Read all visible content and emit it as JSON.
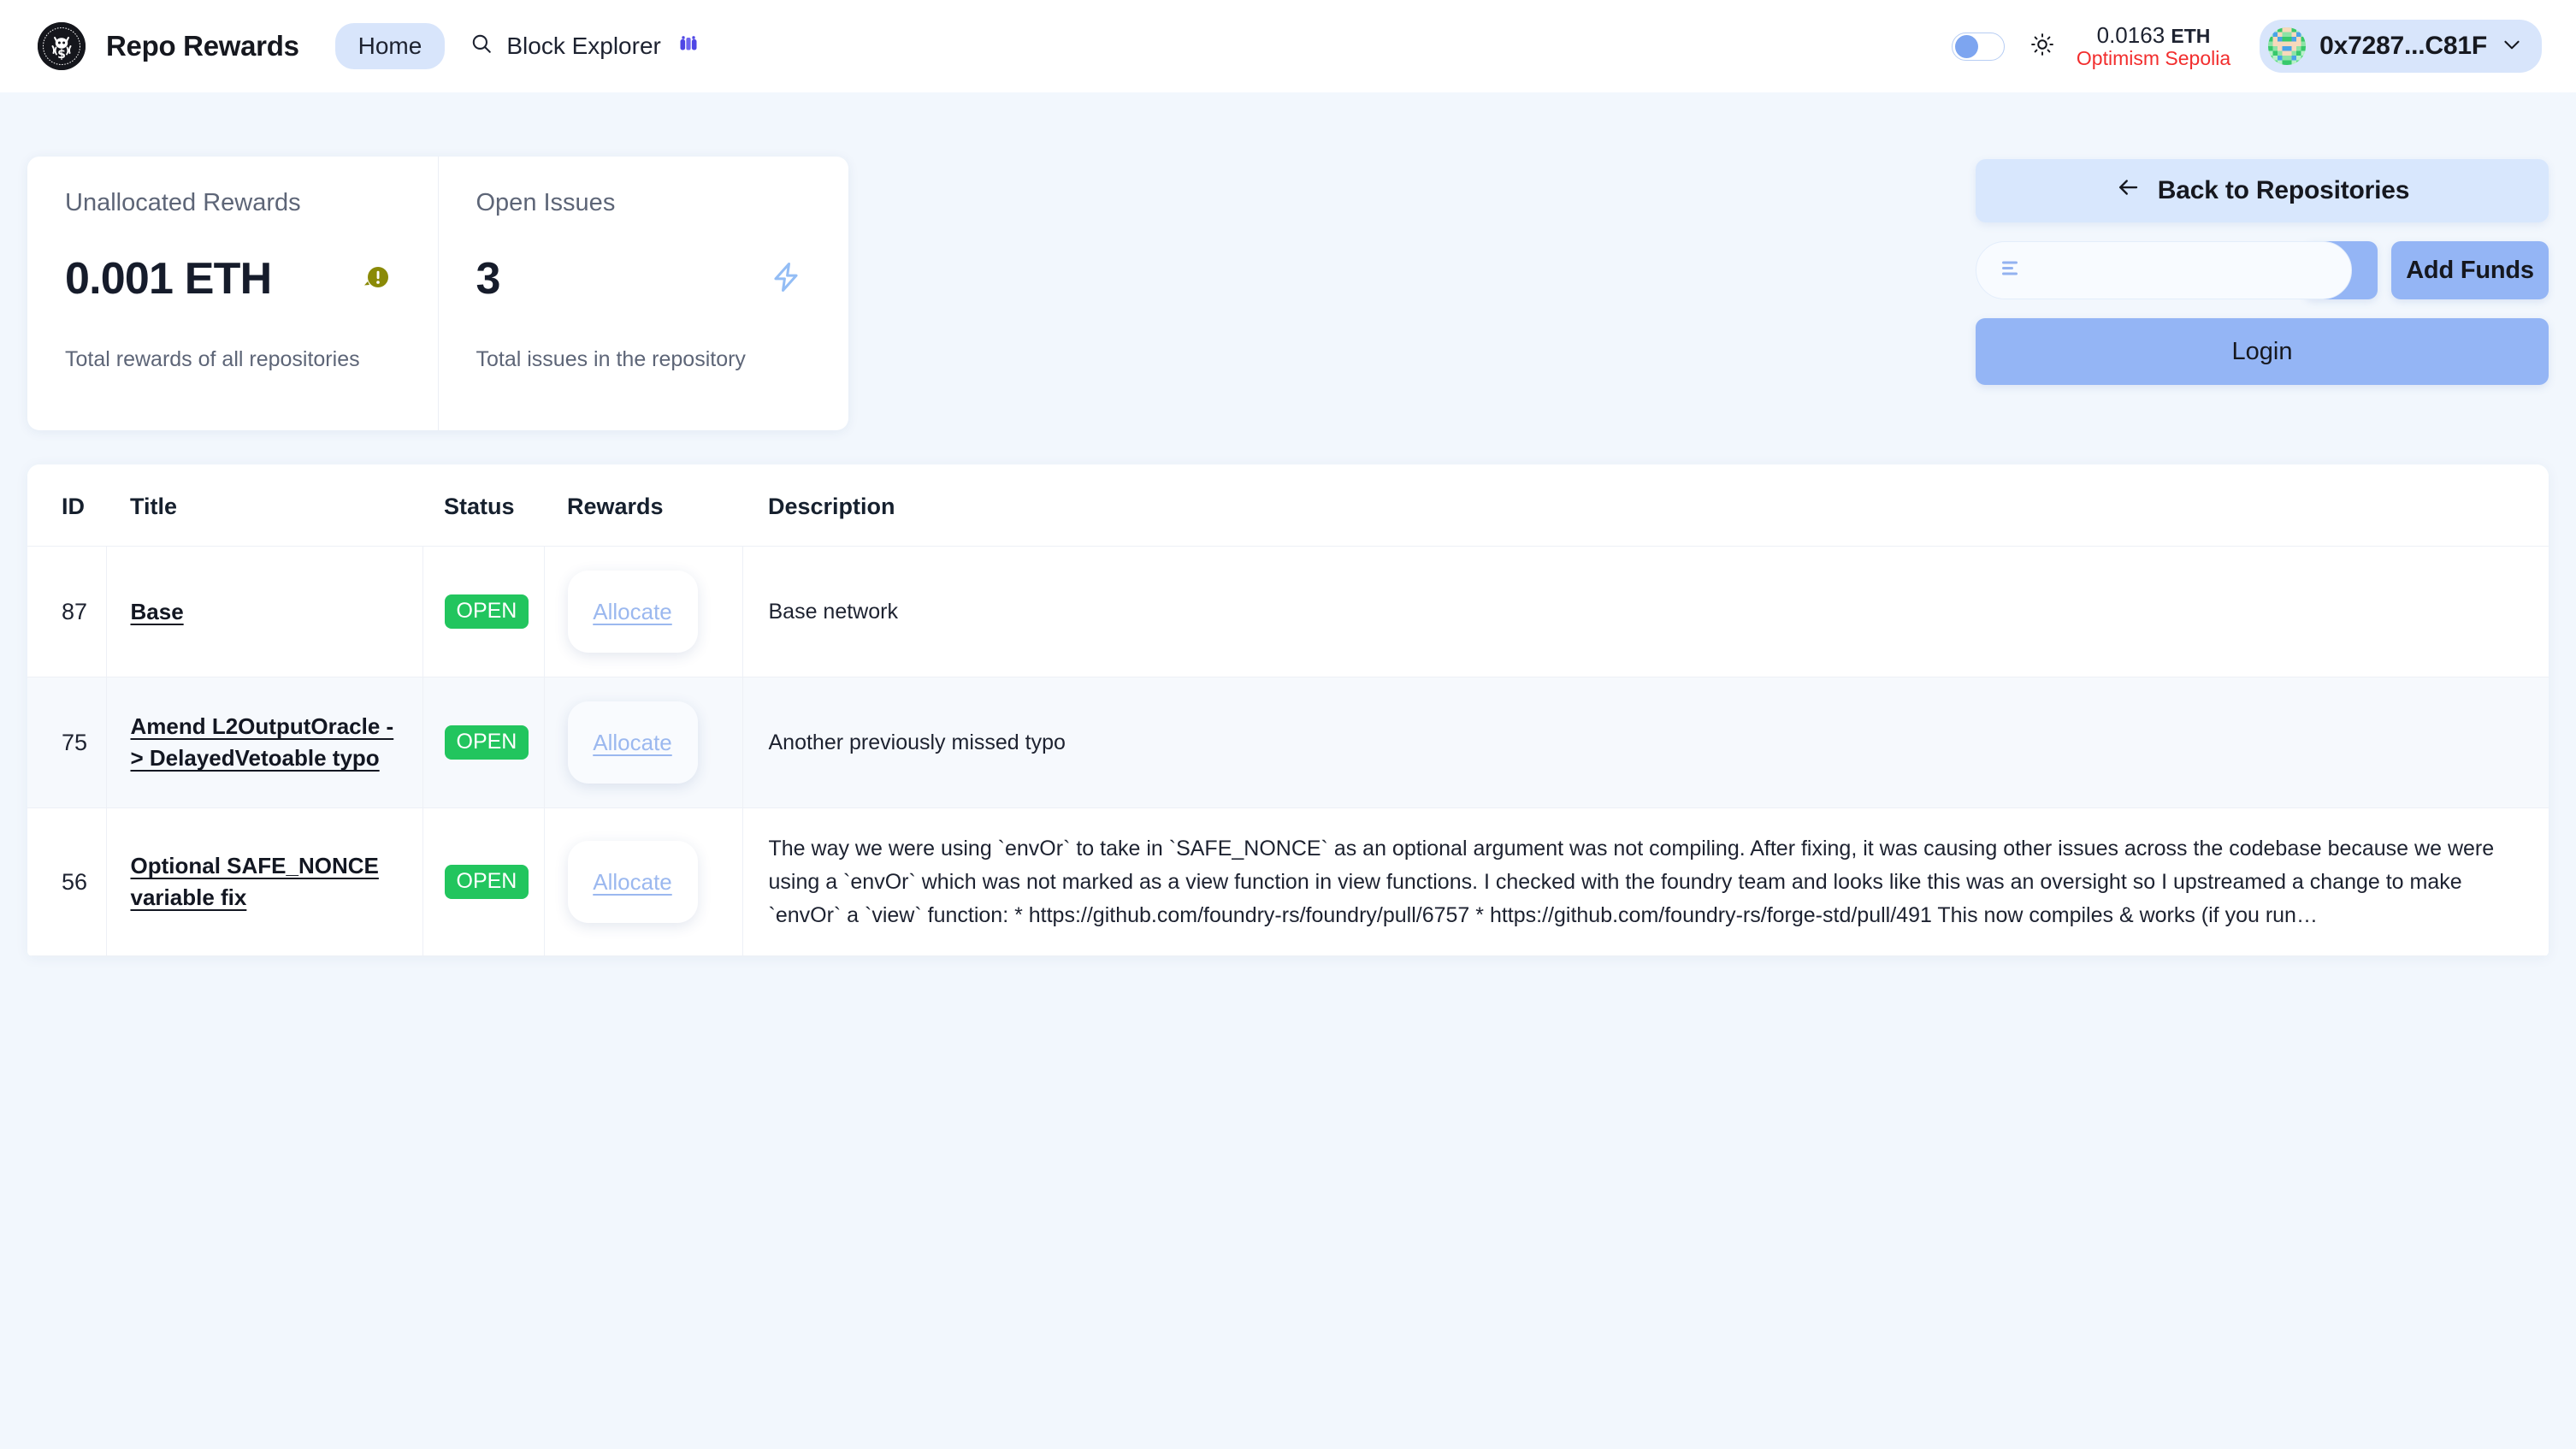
{
  "header": {
    "logo_icon": "repo-rewards-octocat-logo",
    "brand_title": "Repo Rewards",
    "nav": {
      "home_label": "Home",
      "block_explorer_label": "Block Explorer",
      "search_icon": "search-icon",
      "explorer_icon": "binoculars-icon"
    },
    "theme_toggle_icon": "theme-toggle",
    "sun_icon": "sun-icon",
    "balance_amount": "0.0163",
    "balance_unit": "ETH",
    "network": "Optimism Sepolia",
    "account_address": "0x7287...C81F",
    "account_avatar_icon": "identicon-avatar",
    "account_chevron_icon": "chevron-down-icon"
  },
  "stats": [
    {
      "label": "Unallocated Rewards",
      "value": "0.001 ETH",
      "sub": "Total rewards of all repositories",
      "icon": "alert-circle-icon",
      "icon_color": "#8a8a06"
    },
    {
      "label": "Open Issues",
      "value": "3",
      "sub": "Total issues in the repository",
      "icon": "lightning-bolt-icon",
      "icon_color": "#93bdf5"
    }
  ],
  "actions": {
    "back_label": "Back to Repositories",
    "back_arrow_icon": "arrow-left-icon",
    "amount_value": "",
    "amount_placeholder": "",
    "amount_menu_icon": "menu-lines-icon",
    "swap_icon": "swap-arrows-icon",
    "add_funds_label": "Add Funds",
    "login_label": "Login"
  },
  "table": {
    "columns": [
      "ID",
      "Title",
      "Status",
      "Rewards",
      "Description"
    ],
    "allocate_label": "Allocate",
    "rows": [
      {
        "id": "87",
        "title": "Base",
        "status": "OPEN",
        "description": "Base network"
      },
      {
        "id": "75",
        "title": "Amend L2OutputOracle -> DelayedVetoable typo",
        "status": "OPEN",
        "description": "Another previously missed typo"
      },
      {
        "id": "56",
        "title": "Optional SAFE_NONCE variable fix",
        "status": "OPEN",
        "description": "The way we were using `envOr` to take in `SAFE_NONCE` as an optional argument was not compiling. After fixing, it was causing other issues across the codebase because we were using a `envOr` which was not marked as a view function in view functions. I checked with the foundry team and looks like this was an oversight so I upstreamed a change to make `envOr` a `view` function: * https://github.com/foundry-rs/foundry/pull/6757 * https://github.com/foundry-rs/forge-std/pull/491 This now compiles & works (if you run…"
      }
    ]
  },
  "colors": {
    "page_bg": "#f2f7fd",
    "accent_blue": "#94b5f5",
    "pill_blue": "#d8e5fb",
    "status_green": "#22c55e",
    "network_red": "#f22d2d"
  }
}
